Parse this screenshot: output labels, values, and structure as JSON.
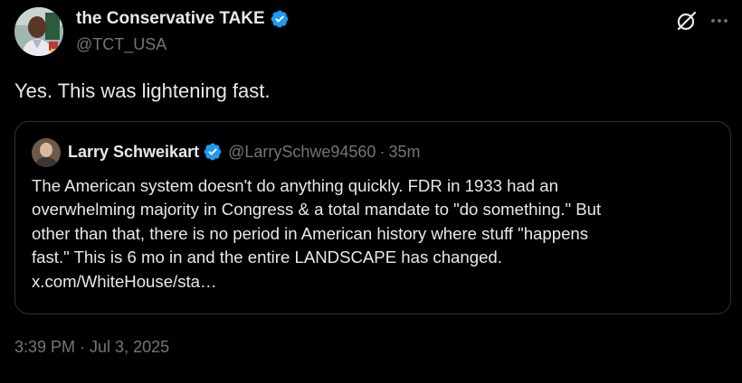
{
  "author": {
    "name": "the Conservative TAKE",
    "handle": "@TCT_USA",
    "verified_icon": "verified-badge-icon",
    "avatar_icon": "avatar-photo"
  },
  "header_actions": {
    "grok_icon": "grok-slash-circle-icon",
    "more_icon": "more-dots-icon"
  },
  "tweet": {
    "text": "Yes. This was lightening fast."
  },
  "quote": {
    "name": "Larry Schweikart",
    "handle": "@LarrySchwe94560",
    "separator": "·",
    "time": "35m",
    "lines": [
      "The American system doesn't do anything quickly. FDR in 1933 had an",
      "overwhelming majority in Congress & a total mandate to \"do something.\" But",
      "other than that, there is no period in American history where stuff \"happens",
      "fast.\" This is 6 mo in and the entire LANDSCAPE has changed.",
      "x.com/WhiteHouse/sta…"
    ]
  },
  "timestamp": {
    "time": "3:39 PM",
    "separator": "·",
    "date": "Jul 3, 2025"
  },
  "colors": {
    "background": "#000000",
    "text": "#e7e9ea",
    "muted": "#71767b",
    "verified": "#1d9bf0",
    "border": "#2f3336"
  }
}
